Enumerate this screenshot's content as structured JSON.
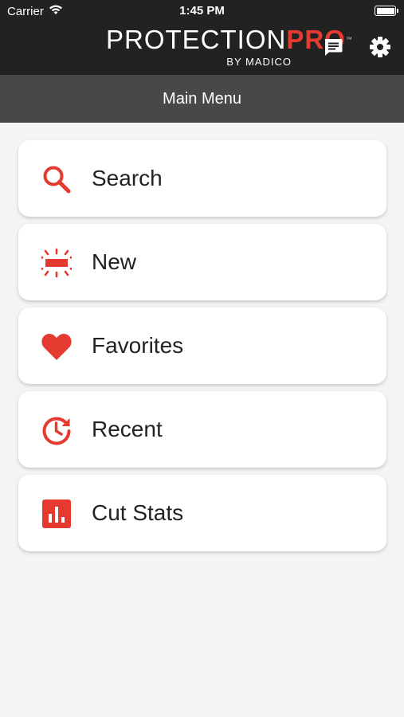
{
  "status_bar": {
    "carrier": "Carrier",
    "time": "1:45 PM"
  },
  "header": {
    "logo_main": "PROTECTION",
    "logo_accent": "PRO",
    "logo_tm": "™",
    "logo_tagline": "BY MADICO",
    "icons": [
      "message-icon",
      "gear-icon"
    ]
  },
  "title_bar": {
    "title": "Main Menu"
  },
  "menu": {
    "items": [
      {
        "label": "Search",
        "icon": "search-icon"
      },
      {
        "label": "New",
        "icon": "new-icon"
      },
      {
        "label": "Favorites",
        "icon": "heart-icon"
      },
      {
        "label": "Recent",
        "icon": "recent-icon"
      },
      {
        "label": "Cut Stats",
        "icon": "bar-chart-icon"
      }
    ]
  },
  "colors": {
    "accent": "#e53a2f",
    "header_bg": "#222222",
    "title_bar_bg": "#484848",
    "page_bg": "#f4f4f4",
    "card_bg": "#ffffff"
  }
}
